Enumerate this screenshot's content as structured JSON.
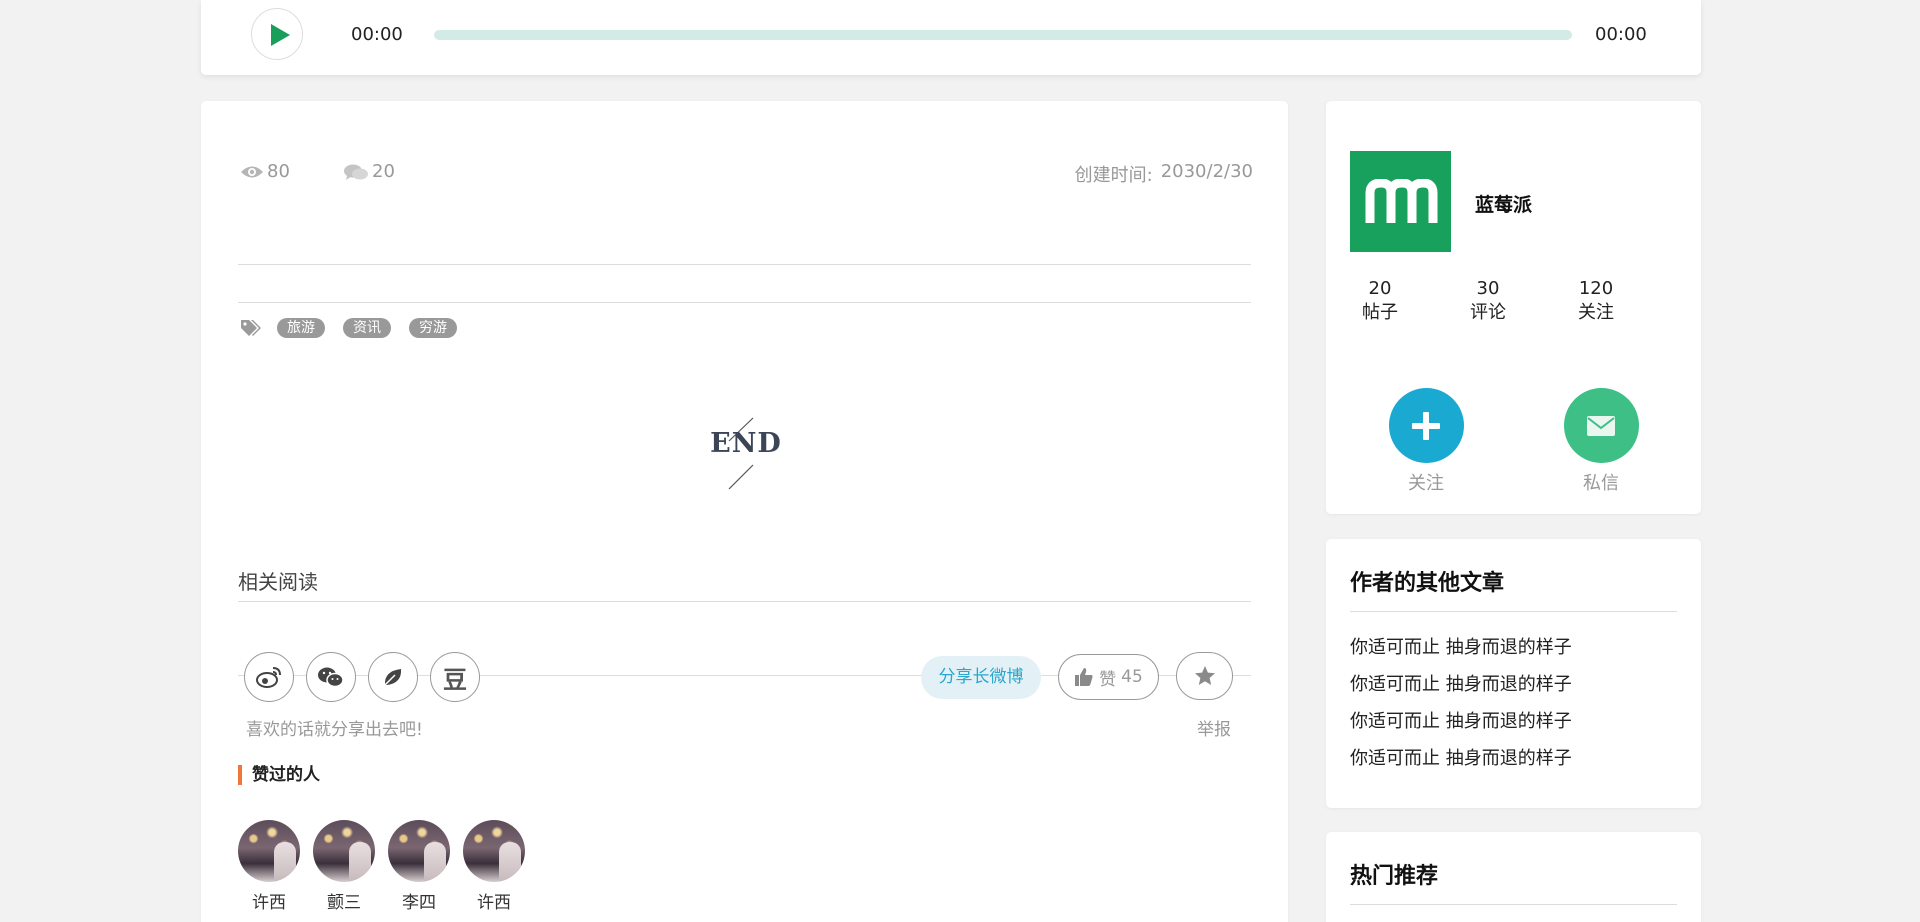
{
  "player": {
    "current_time": "00:00",
    "total_time": "00:00",
    "progress": 0
  },
  "article": {
    "views": "80",
    "comments": "20",
    "created_label": "创建时间:",
    "created_date": "2030/2/30",
    "tags": [
      "旅游",
      "资讯",
      "穷游"
    ],
    "end_text": "END",
    "related_title": "相关阅读"
  },
  "share": {
    "douban_label": "豆",
    "weibo_long_label": "分享长微博",
    "like_label": "赞",
    "like_count": "45",
    "hint": "喜欢的话就分享出去吧!",
    "report_label": "举报"
  },
  "likers": {
    "title": "赞过的人",
    "people": [
      "许西",
      "颤三",
      "李四",
      "许西"
    ]
  },
  "profile": {
    "name": "蓝莓派",
    "stats": [
      {
        "value": "20",
        "label": "帖子"
      },
      {
        "value": "30",
        "label": "评论"
      },
      {
        "value": "120",
        "label": "关注"
      }
    ],
    "follow_label": "关注",
    "message_label": "私信"
  },
  "other_articles": {
    "title": "作者的其他文章",
    "items": [
      "你适可而止 抽身而退的样子",
      "你适可而止 抽身而退的样子",
      "你适可而止 抽身而退的样子",
      "你适可而止 抽身而退的样子"
    ]
  },
  "hot": {
    "title": "热门推荐"
  },
  "colors": {
    "brand_green": "#18a15d",
    "play_green": "#1a9e5c",
    "follow_blue": "#1aa9d1",
    "message_green": "#3dbf86",
    "tag_gray": "#999999",
    "likers_accent": "#f0773a",
    "weibo_blue": "#2aa7cc"
  },
  "icons": [
    "play-icon",
    "eye-icon",
    "comment-icon",
    "tag-icon",
    "weibo-icon",
    "wechat-icon",
    "leaf-icon",
    "thumbs-up-icon",
    "star-icon",
    "plus-icon",
    "mail-icon",
    "m-logo-icon"
  ]
}
